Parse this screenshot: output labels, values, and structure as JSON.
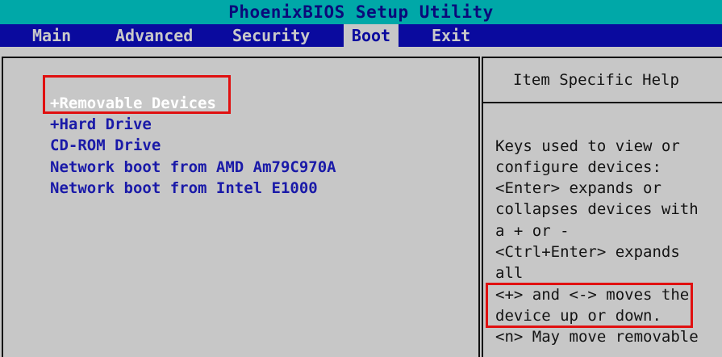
{
  "window": {
    "title": "PhoenixBIOS Setup Utility"
  },
  "menu": {
    "items": [
      {
        "label": "Main"
      },
      {
        "label": "Advanced"
      },
      {
        "label": "Security"
      },
      {
        "label": "Boot",
        "active": true
      },
      {
        "label": "Exit"
      }
    ]
  },
  "boot_order": {
    "items": [
      {
        "label": "+Removable Devices",
        "selected": true
      },
      {
        "label": "+Hard Drive"
      },
      {
        "label": " CD-ROM Drive"
      },
      {
        "label": " Network boot from AMD Am79C970A"
      },
      {
        "label": " Network boot from Intel E1000"
      }
    ]
  },
  "help": {
    "title": "Item Specific Help",
    "lines": [
      "Keys used to view or",
      "configure devices:",
      "<Enter> expands or",
      "collapses devices with",
      "a + or -",
      "<Ctrl+Enter> expands",
      "all",
      "<+> and <-> moves the",
      "device up or down.",
      "<n> May move removable"
    ]
  },
  "colors": {
    "title_bar": "#00a8a8",
    "menu_bar": "#0a0a9e",
    "background": "#c7c7c7",
    "item_text": "#1a1aa8",
    "selected_text": "#ffffff",
    "highlight_box": "#e01010"
  }
}
